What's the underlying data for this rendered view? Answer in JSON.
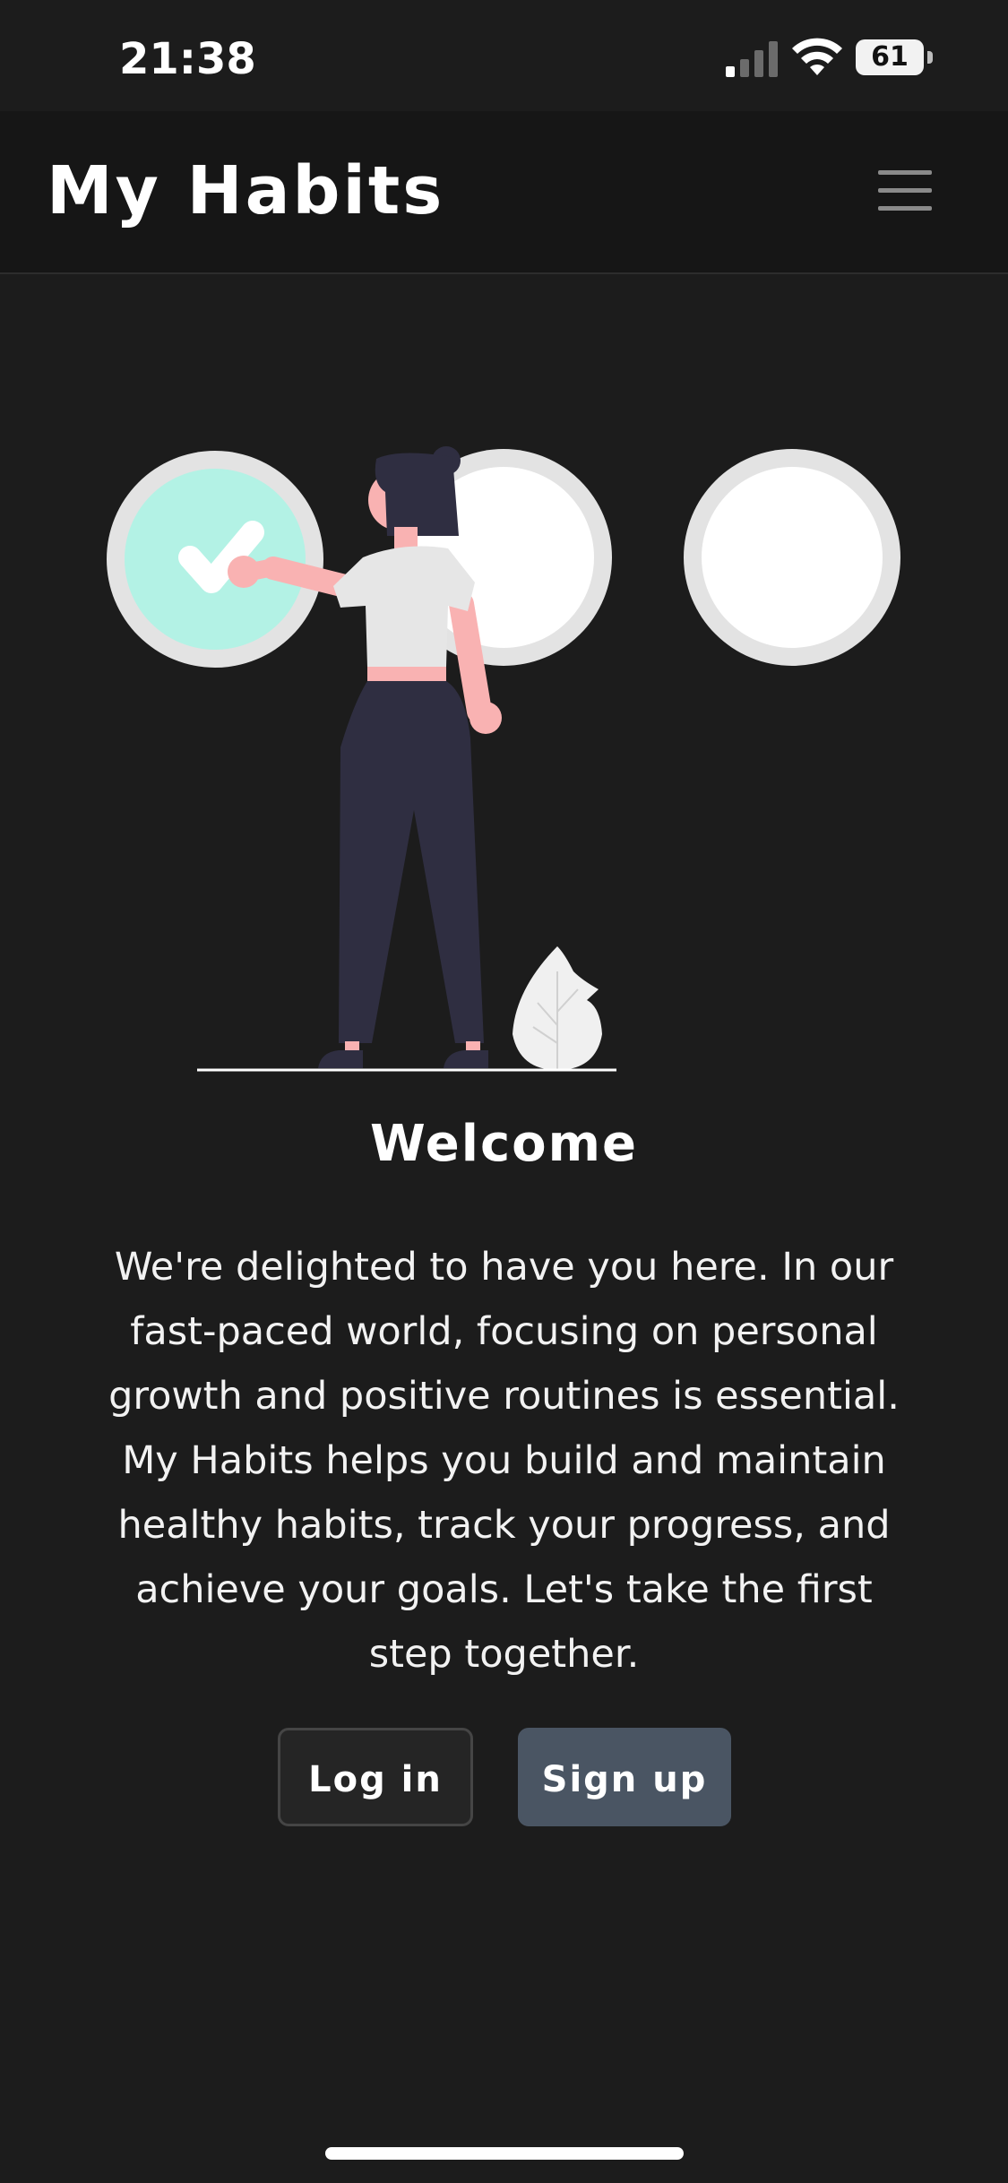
{
  "status_bar": {
    "time": "21:38",
    "battery": "61",
    "icons": [
      "signal-icon",
      "wifi-icon",
      "battery-icon"
    ]
  },
  "header": {
    "title": "My Habits",
    "menu_icon": "hamburger-menu-icon"
  },
  "illustration": {
    "description_icon": "woman-checking-habits-illustration",
    "circles": [
      {
        "state": "checked",
        "fill": "#b3f2e5",
        "icon": "checkmark-icon"
      },
      {
        "state": "unchecked",
        "fill": "#ffffff"
      },
      {
        "state": "unchecked",
        "fill": "#ffffff"
      }
    ]
  },
  "welcome": {
    "title": "Welcome",
    "body": "We're delighted to have you here. In our fast-paced world, focusing on personal growth and positive routines is essential. My Habits helps you build and maintain healthy habits, track your progress, and achieve your goals. Let's take the first step together."
  },
  "actions": {
    "login_label": "Log in",
    "signup_label": "Sign up"
  },
  "colors": {
    "background": "#1c1c1c",
    "navbar": "#161616",
    "accent_check": "#b3f2e5",
    "signup_button": "#4a5563",
    "login_button": "#252525"
  }
}
